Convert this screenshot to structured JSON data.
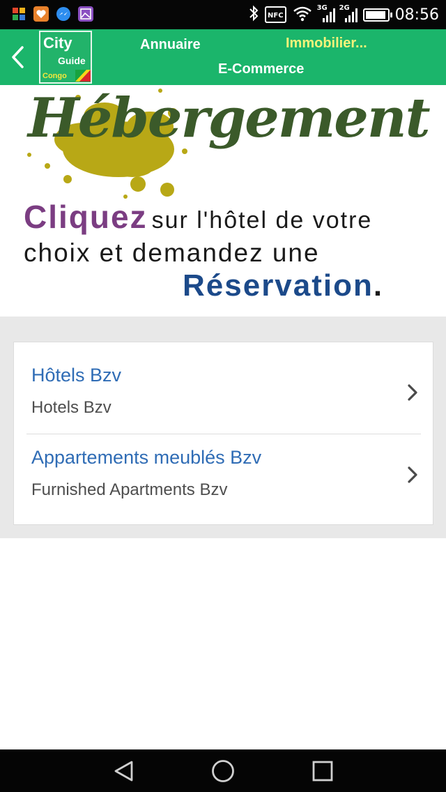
{
  "status_bar": {
    "notification_icons": [
      "puzzle-app-icon",
      "health-app-icon",
      "messenger-icon",
      "gallery-app-icon"
    ],
    "bluetooth_icon": "bluetooth-icon",
    "nfc_label": "NFC",
    "wifi_icon": "wifi-icon",
    "network_3g": "3G",
    "network_2g": "2G",
    "time": "08:56"
  },
  "header": {
    "back_icon": "chevron-left-icon",
    "logo": {
      "line1": "City",
      "line2": "Guide",
      "line3": "Congo"
    },
    "nav": {
      "annuaire": "Annuaire",
      "immobilier": "Immobilier...",
      "ecommerce": "E-Commerce"
    },
    "colors": {
      "background": "#1bb56b",
      "highlight": "#f5f27a"
    }
  },
  "banner": {
    "title": "Hébergement",
    "word_highlight": "Cliquez",
    "line1_rest": "sur l'hôtel de votre",
    "line2": "choix et demandez une",
    "word_final": "Réservation",
    "final_dot": ".",
    "colors": {
      "title": "#3b5a2a",
      "highlight": "#7b3d82",
      "final": "#1c4a8a",
      "splash": "#b8a816"
    }
  },
  "list": {
    "items": [
      {
        "title": "Hôtels Bzv",
        "subtitle": "Hotels Bzv"
      },
      {
        "title": "Appartements meublés Bzv",
        "subtitle": "Furnished Apartments Bzv"
      }
    ],
    "chevron_icon": "chevron-right-icon",
    "colors": {
      "title": "#2f6cb5",
      "subtitle": "#4e4e4e"
    }
  },
  "navigation_bar": {
    "back_icon": "triangle-back-icon",
    "home_icon": "circle-home-icon",
    "recents_icon": "square-recents-icon"
  }
}
